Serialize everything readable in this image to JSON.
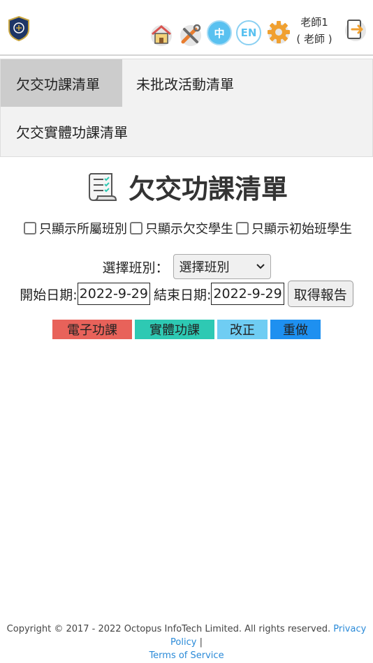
{
  "header": {
    "user_name": "老師1",
    "user_role": "( 老師 )",
    "lang_zh": "中",
    "lang_en": "EN"
  },
  "tabs": [
    {
      "label": "欠交功課清單",
      "active": true
    },
    {
      "label": "未批改活動清單",
      "active": false
    },
    {
      "label": "欠交實體功課清單",
      "active": false
    }
  ],
  "page": {
    "title": "欠交功課清單"
  },
  "filters": [
    {
      "label": "只顯示所屬班別",
      "checked": false
    },
    {
      "label": "只顯示欠交學生",
      "checked": false
    },
    {
      "label": "只顯示初始班學生",
      "checked": false
    }
  ],
  "form": {
    "class_label": "選擇班別：",
    "class_select_value": "選擇班別",
    "start_label": "開始日期:",
    "start_value": "2022-9-29",
    "end_label": "結束日期:",
    "end_value": "2022-9-29",
    "get_report_label": "取得報告"
  },
  "categories": [
    {
      "label": "電子功課",
      "color": "#e8625a"
    },
    {
      "label": "實體功課",
      "color": "#2ec9b3"
    },
    {
      "label": "改正",
      "color": "#6fcdf3"
    },
    {
      "label": "重做",
      "color": "#1e90f0"
    }
  ],
  "footer": {
    "copyright": "Copyright © 2017 - 2022 Octopus InfoTech Limited. All rights reserved.",
    "privacy": "Privacy Policy",
    "separator": "|",
    "terms": "Terms of Service"
  },
  "colors": {
    "accent": "#59c1f0",
    "tab_active": "#cccccc",
    "tab_bar": "#f2f2f2",
    "gear": "#f0a030",
    "link": "#2a8ad8"
  },
  "icons": [
    "school-logo-icon",
    "home-icon",
    "tools-icon",
    "gear-icon",
    "logout-icon",
    "checklist-icon",
    "chevron-down-icon"
  ]
}
